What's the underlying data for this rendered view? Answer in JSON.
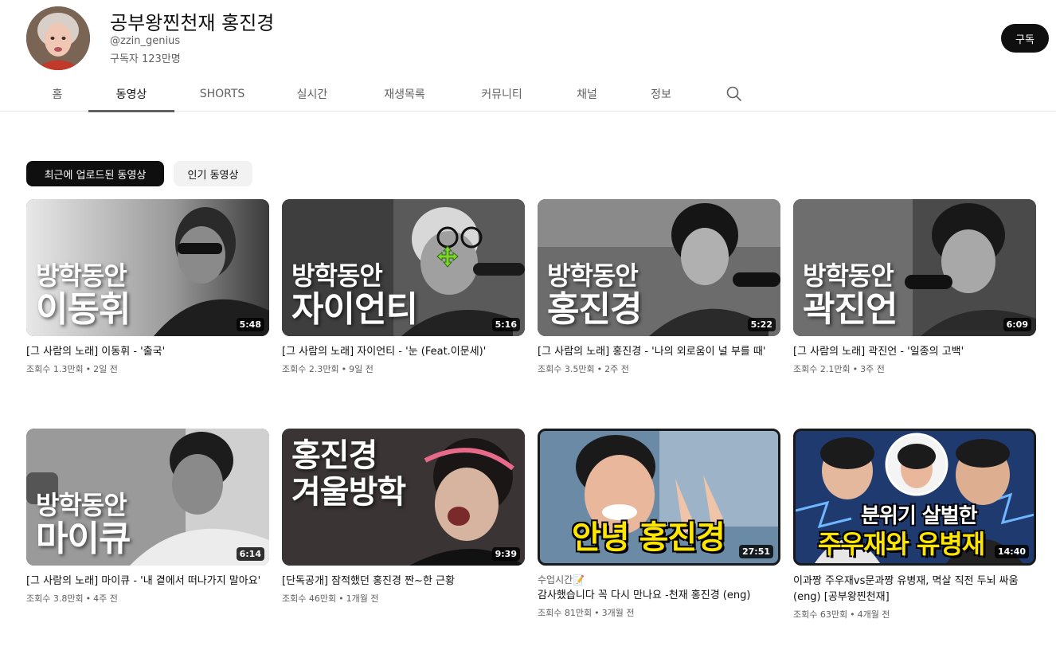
{
  "channel": {
    "name": "공부왕찐천재 홍진경",
    "handle": "@zzin_genius",
    "subscribers": "구독자 123만명",
    "subscribe_label": "구독"
  },
  "tabs": [
    {
      "label": "홈"
    },
    {
      "label": "동영상"
    },
    {
      "label": "SHORTS"
    },
    {
      "label": "실시간"
    },
    {
      "label": "재생목록"
    },
    {
      "label": "커뮤니티"
    },
    {
      "label": "채널"
    },
    {
      "label": "정보"
    }
  ],
  "active_tab": "동영상",
  "chips": [
    {
      "label": "최근에 업로드된 동영상",
      "selected": true
    },
    {
      "label": "인기 동영상",
      "selected": false
    }
  ],
  "videos": [
    {
      "title": "[그 사람의 노래] 이동휘 - '출국'",
      "views": "조회수 1.3만회",
      "age": "2일 전",
      "duration": "5:48",
      "overlay_top": "방학동안",
      "overlay_bottom": "이동휘"
    },
    {
      "title": "[그 사람의 노래] 자이언티 - '눈 (Feat.이문세)'",
      "views": "조회수 2.3만회",
      "age": "9일 전",
      "duration": "5:16",
      "overlay_top": "방학동안",
      "overlay_bottom": "자이언티"
    },
    {
      "title": "[그 사람의 노래] 홍진경 - '나의 외로움이 널 부를 때'",
      "views": "조회수 3.5만회",
      "age": "2주 전",
      "duration": "5:22",
      "overlay_top": "방학동안",
      "overlay_bottom": "홍진경"
    },
    {
      "title": "[그 사람의 노래] 곽진언 - '일종의 고백'",
      "views": "조회수 2.1만회",
      "age": "3주 전",
      "duration": "6:09",
      "overlay_top": "방학동안",
      "overlay_bottom": "곽진언"
    },
    {
      "title": "[그 사람의 노래] 마이큐 - '내 곁에서 떠나가지 말아요'",
      "views": "조회수 3.8만회",
      "age": "4주 전",
      "duration": "6:14",
      "overlay_top": "방학동안",
      "overlay_bottom": "마이큐"
    },
    {
      "title": "[단독공개] 잠적했던 홍진경 짠~한 근황",
      "views": "조회수 46만회",
      "age": "1개월 전",
      "duration": "9:39",
      "overlay_top": "홍진경",
      "overlay_bottom": "겨울방학"
    },
    {
      "pre_title": "수업시간📝",
      "title": "감사했습니다 꼭 다시 만나요 -천재 홍진경 (eng)",
      "views": "조회수 81만회",
      "age": "3개월 전",
      "duration": "27:51",
      "overlay_top": "",
      "overlay_bottom": "안녕 홍진경"
    },
    {
      "title": "이과짱 주우재vs문과짱 유병재, 멱살 직전 두뇌 싸움 (eng) [공부왕찐천재]",
      "views": "조회수 63만회",
      "age": "4개월 전",
      "duration": "14:40",
      "overlay_top": "분위기 살벌한",
      "overlay_bottom": "주우재와 유병재"
    }
  ],
  "colors": {
    "accent_yellow": "#ffe600",
    "subscribe_bg": "#0f0f0f",
    "meta_gray": "#606060"
  },
  "icons": [
    "search-icon",
    "move-cursor-icon"
  ]
}
